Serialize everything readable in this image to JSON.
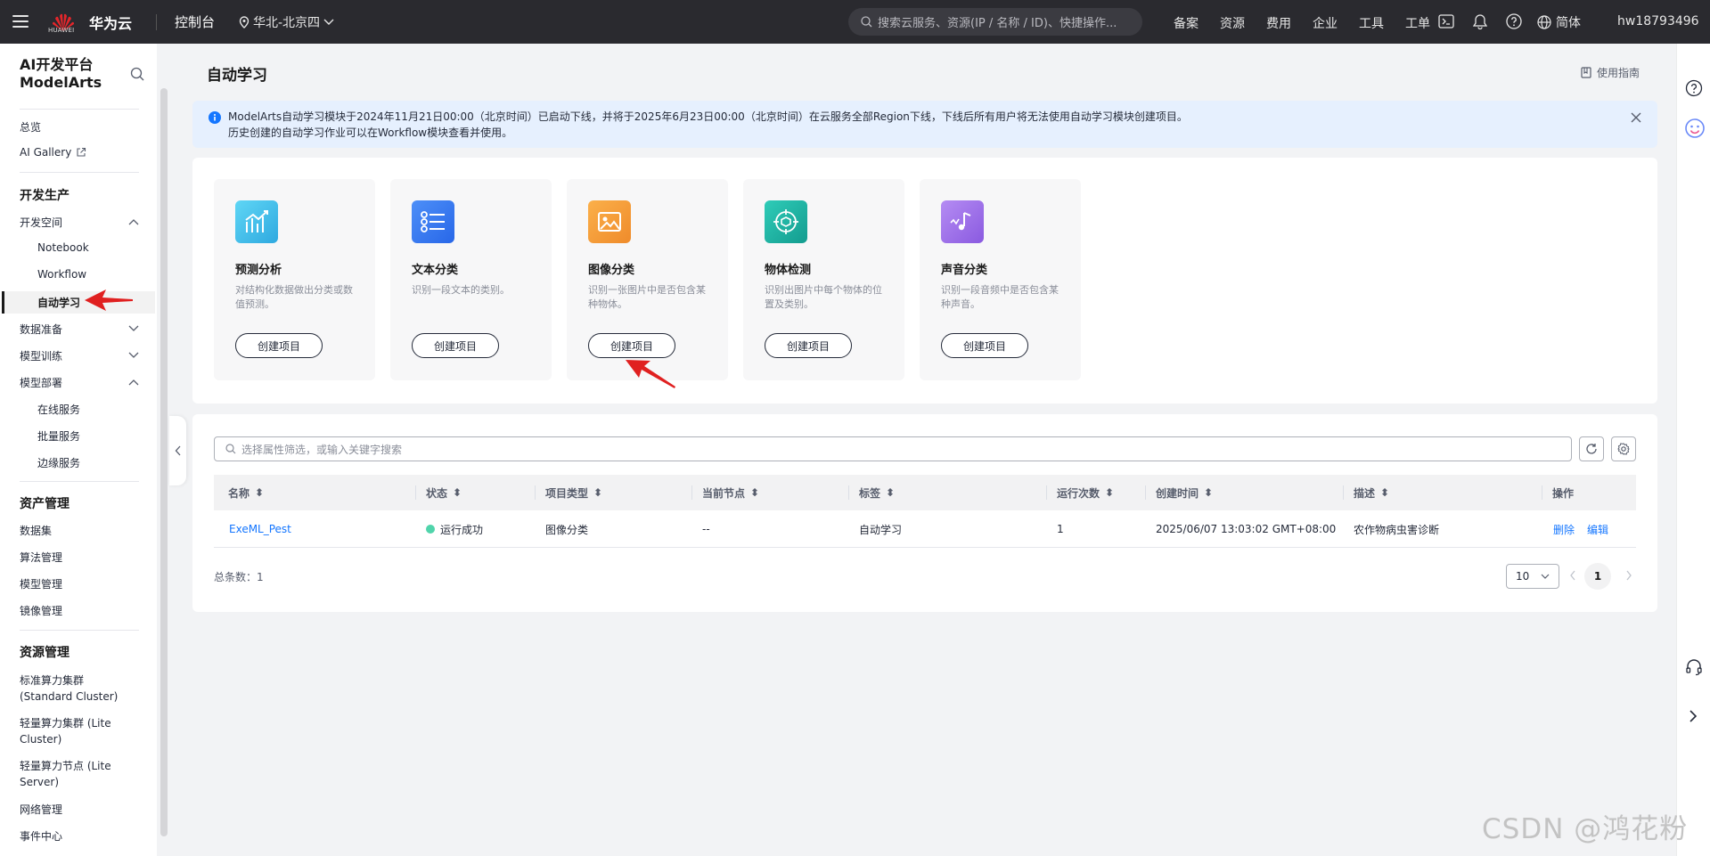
{
  "topbar": {
    "brand": "华为云",
    "logo_text": "HUAWEI",
    "console": "控制台",
    "region": "华北-北京四",
    "search_placeholder": "搜索云服务、资源(IP / 名称 / ID)、快捷操作...",
    "nav": [
      "备案",
      "资源",
      "费用",
      "企业",
      "工具",
      "工单"
    ],
    "language": "简体",
    "user": "hw18793496",
    "icons": [
      "terminal-icon",
      "bell-icon",
      "help-icon",
      "globe-icon"
    ]
  },
  "sidebar": {
    "title_line1": "AI开发平台",
    "title_line2": "ModelArts",
    "overview": "总览",
    "gallery": "AI Gallery",
    "group_dev": "开发生产",
    "dev_space": "开发空间",
    "notebook": "Notebook",
    "workflow": "Workflow",
    "automl": "自动学习",
    "data_prep": "数据准备",
    "model_train": "模型训练",
    "model_deploy": "模型部署",
    "online_service": "在线服务",
    "batch_service": "批量服务",
    "edge_service": "边缘服务",
    "group_asset": "资产管理",
    "dataset": "数据集",
    "algorithm": "算法管理",
    "model_mgmt": "模型管理",
    "image_mgmt": "镜像管理",
    "group_resource": "资源管理",
    "std_cluster_1": "标准算力集群",
    "std_cluster_2": "(Standard Cluster)",
    "lite_cluster_1": "轻量算力集群 (Lite",
    "lite_cluster_2": "Cluster)",
    "lite_server_1": "轻量算力节点 (Lite",
    "lite_server_2": "Server)",
    "network": "网络管理",
    "event": "事件中心"
  },
  "page": {
    "title": "自动学习",
    "guide": "使用指南",
    "notice_line1": "ModelArts自动学习模块于2024年11月21日00:00（北京时间）已启动下线，并将于2025年6月23日00:00（北京时间）在云服务全部Region下线，下线后所有用户将无法使用自动学习模块创建项目。",
    "notice_line2": "历史创建的自动学习作业可以在Workflow模块查看并使用。"
  },
  "cards": [
    {
      "title": "预测分析",
      "desc": "对结构化数据做出分类或数值预测。",
      "button": "创建项目",
      "color": "#3ec1e8"
    },
    {
      "title": "文本分类",
      "desc": "识别一段文本的类别。",
      "button": "创建项目",
      "color": "#3478f6"
    },
    {
      "title": "图像分类",
      "desc": "识别一张图片中是否包含某种物体。",
      "button": "创建项目",
      "color": "#f5a23a"
    },
    {
      "title": "物体检测",
      "desc": "识别出图片中每个物体的位置及类别。",
      "button": "创建项目",
      "color": "#21b8a8"
    },
    {
      "title": "声音分类",
      "desc": "识别一段音频中是否包含某种声音。",
      "button": "创建项目",
      "color": "#9b6fe6"
    }
  ],
  "table": {
    "filter_placeholder": "选择属性筛选，或输入关键字搜索",
    "columns": [
      "名称",
      "状态",
      "项目类型",
      "当前节点",
      "标签",
      "运行次数",
      "创建时间",
      "描述",
      "操作"
    ],
    "rows": [
      {
        "name": "ExeML_Pest",
        "status": "运行成功",
        "type": "图像分类",
        "node": "--",
        "tag": "自动学习",
        "runs": "1",
        "created": "2025/06/07 13:03:02 GMT+08:00",
        "desc": "农作物病虫害诊断",
        "action_delete": "删除",
        "action_edit": "编辑"
      }
    ],
    "total_label": "总条数：1",
    "page_size": "10",
    "current_page": "1"
  },
  "watermark": "CSDN @鸿花粉",
  "colors": {
    "accent": "#1476ff",
    "success": "#50d4ab",
    "topbar": "#2a2a2f",
    "arrow": "#e02020"
  }
}
